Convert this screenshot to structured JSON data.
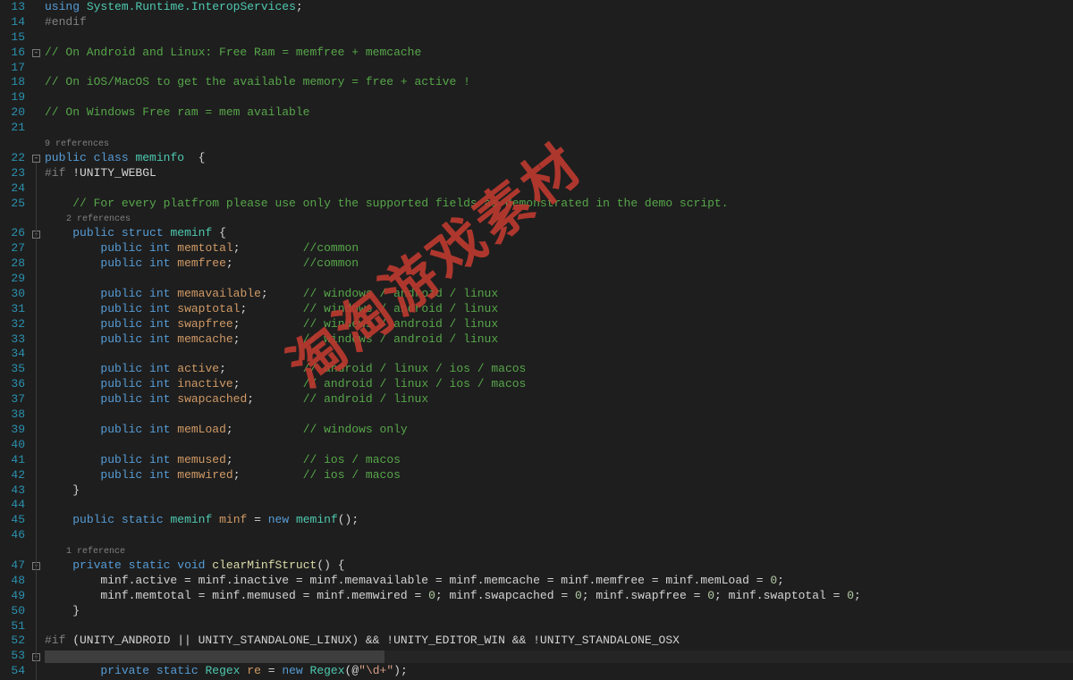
{
  "watermark": "淘淘游戏素材",
  "gutter": {
    "start": 13,
    "end": 54
  },
  "codelens": {
    "classRefs": "9 references",
    "structRefs": "2 references",
    "methodRefs": "1 reference"
  },
  "code": {
    "l13": {
      "using": "using",
      "ns": "System.Runtime.InteropServices",
      "semi": ";"
    },
    "l14": {
      "pp": "#endif"
    },
    "l16": {
      "cmt": "// On Android and Linux: Free Ram = memfree + memcache"
    },
    "l18": {
      "cmt": "// On iOS/MacOS to get the available memory = free + active !"
    },
    "l20": {
      "cmt": "// On Windows Free ram = mem available"
    },
    "l22": {
      "kw1": "public",
      "kw2": "class",
      "name": "meminfo",
      "brace": "  {"
    },
    "l23": {
      "pp": "#if",
      "sym": " !UNITY_WEBGL"
    },
    "l25": {
      "cmt": "// For every platfrom please use only the supported fields as demonstrated in the demo script."
    },
    "l26": {
      "kw1": "public",
      "kw2": "struct",
      "name": "meminf",
      "brace": " {"
    },
    "l27": {
      "kw1": "public",
      "kw2": "int",
      "name": "memtotal",
      "semi": ";",
      "cmt": "//common"
    },
    "l28": {
      "kw1": "public",
      "kw2": "int",
      "name": "memfree",
      "semi": ";",
      "cmt": "//common"
    },
    "l30": {
      "kw1": "public",
      "kw2": "int",
      "name": "memavailable",
      "semi": ";",
      "cmt": "// windows / android / linux"
    },
    "l31": {
      "kw1": "public",
      "kw2": "int",
      "name": "swaptotal",
      "semi": ";",
      "cmt": "// windows / android / linux"
    },
    "l32": {
      "kw1": "public",
      "kw2": "int",
      "name": "swapfree",
      "semi": ";",
      "cmt": "// windows / android / linux"
    },
    "l33": {
      "kw1": "public",
      "kw2": "int",
      "name": "memcache",
      "semi": ";",
      "cmt": "// windows / android / linux"
    },
    "l35": {
      "kw1": "public",
      "kw2": "int",
      "name": "active",
      "semi": ";",
      "cmt": "// android / linux / ios / macos"
    },
    "l36": {
      "kw1": "public",
      "kw2": "int",
      "name": "inactive",
      "semi": ";",
      "cmt": "// android / linux / ios / macos"
    },
    "l37": {
      "kw1": "public",
      "kw2": "int",
      "name": "swapcached",
      "semi": ";",
      "cmt": "// android / linux"
    },
    "l39": {
      "kw1": "public",
      "kw2": "int",
      "name": "memLoad",
      "semi": ";",
      "cmt": "// windows only"
    },
    "l41": {
      "kw1": "public",
      "kw2": "int",
      "name": "memused",
      "semi": ";",
      "cmt": "// ios / macos"
    },
    "l42": {
      "kw1": "public",
      "kw2": "int",
      "name": "memwired",
      "semi": ";",
      "cmt": "// ios / macos"
    },
    "l43": {
      "brace": "}"
    },
    "l45": {
      "kw1": "public",
      "kw2": "static",
      "type": "meminf",
      "name": "minf",
      "eq": " = ",
      "new": "new",
      "ctor": "meminf",
      "tail": "();"
    },
    "l47": {
      "kw1": "private",
      "kw2": "static",
      "kw3": "void",
      "name": "clearMinfStruct",
      "tail": "() {"
    },
    "l48": {
      "a": "minf.active = minf.inactive = minf.memavailable = minf.memcache = minf.memfree = minf.memLoad = ",
      "n": "0",
      "semi": ";"
    },
    "l49": {
      "a": "minf.memtotal = minf.memused = minf.memwired = ",
      "n1": "0",
      "b": "; minf.swapcached = ",
      "n2": "0",
      "c": "; minf.swapfree = ",
      "n3": "0",
      "d": "; minf.swaptotal = ",
      "n4": "0",
      "semi": ";"
    },
    "l50": {
      "brace": "}"
    },
    "l52": {
      "pp": "#if",
      "expr": " (UNITY_ANDROID || UNITY_STANDALONE_LINUX) && !UNITY_EDITOR_WIN && !UNITY_STANDALONE_OSX"
    },
    "l54": {
      "kw1": "private",
      "kw2": "static",
      "type": "Regex",
      "name": "re",
      "eq": " = ",
      "new": "new",
      "ctor": "Regex",
      "paren": "(@",
      "str": "\"\\d+\"",
      "tail": ");"
    }
  }
}
